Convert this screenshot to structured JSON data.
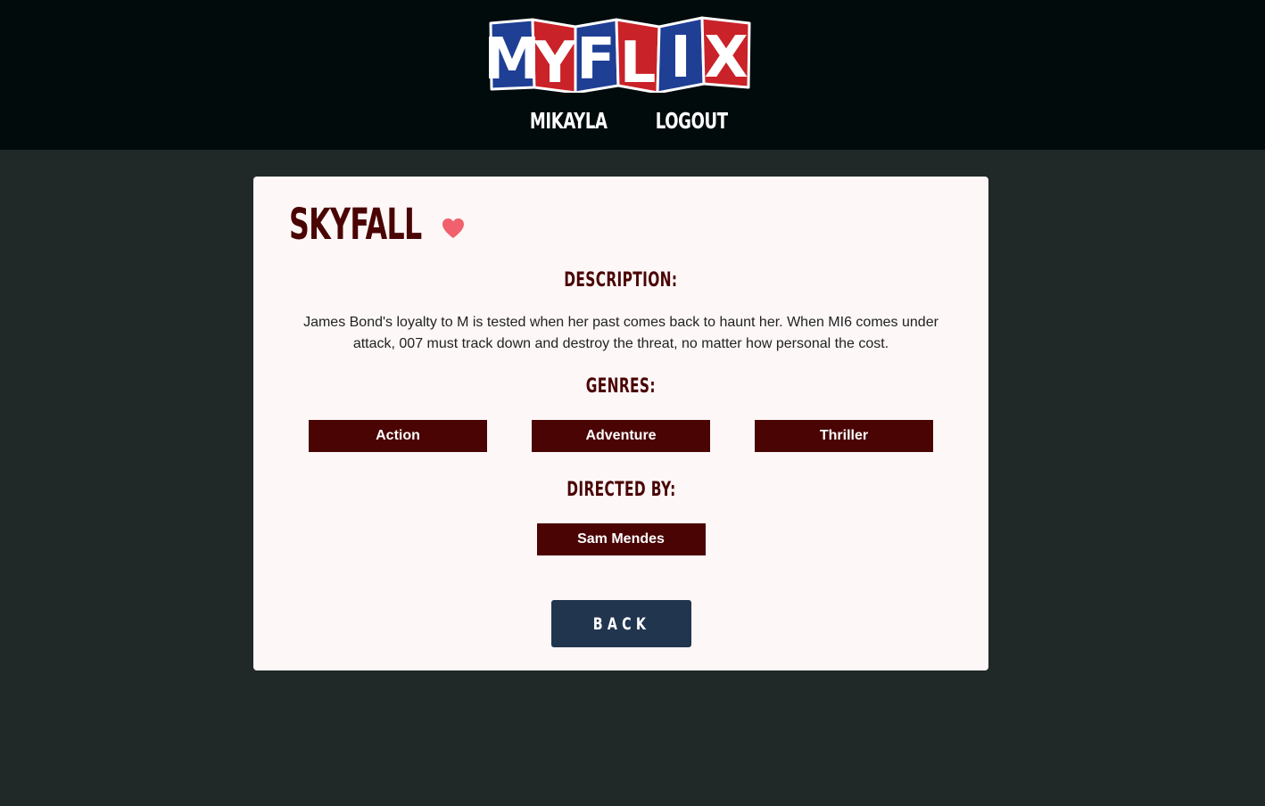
{
  "header": {
    "logo_text": "MYFLIX",
    "nav": [
      {
        "label": "MIKAYLA"
      },
      {
        "label": "LOGOUT"
      }
    ]
  },
  "movie": {
    "title": "SKYFALL",
    "favorite_icon": "heart-icon",
    "description_label": "DESCRIPTION:",
    "description": "James Bond's loyalty to M is tested when her past comes back to haunt her. When MI6 comes under attack, 007 must track down and destroy the threat, no matter how personal the cost.",
    "genres_label": "GENRES:",
    "genres": [
      "Action",
      "Adventure",
      "Thriller"
    ],
    "director_label": "DIRECTED BY:",
    "director": "Sam Mendes",
    "back_label": "BACK"
  },
  "colors": {
    "header_bg": "#010b0c",
    "page_bg": "#212828",
    "card_bg": "#fdf7f7",
    "accent": "#4a0404",
    "heart": "#f0616d",
    "back_button": "#21354f",
    "logo_red": "#c92228",
    "logo_blue": "#1f3f95"
  }
}
